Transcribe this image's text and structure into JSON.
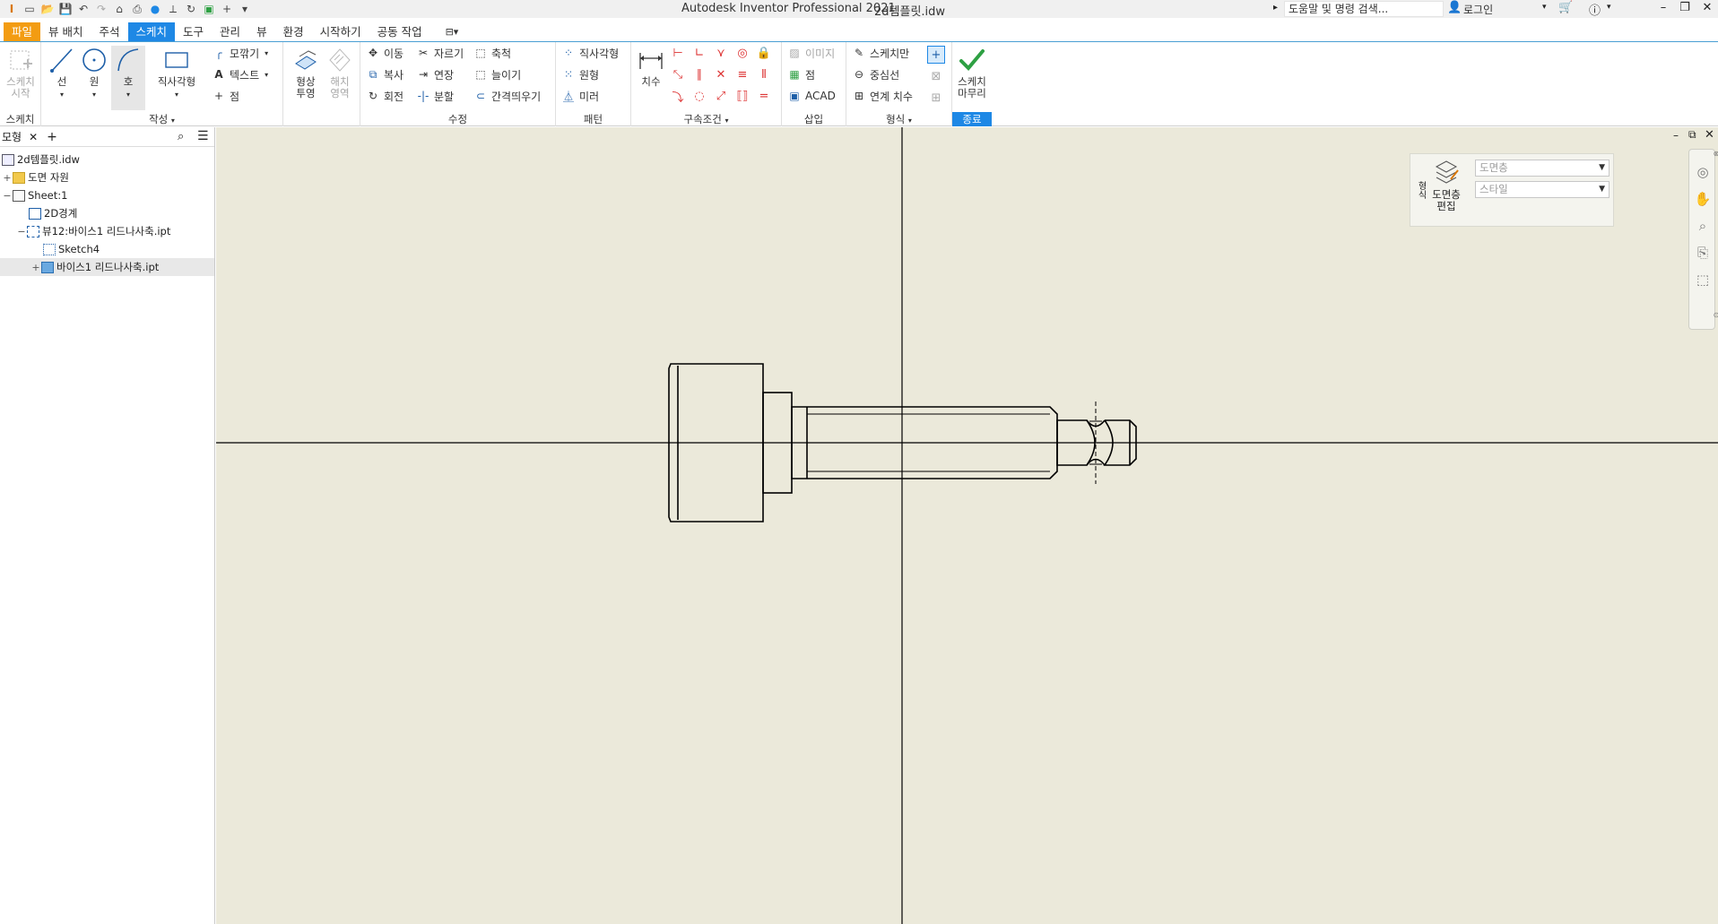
{
  "titlebar": {
    "app_title": "Autodesk Inventor Professional 2021",
    "doc_title": "2d템플릿.idw",
    "search_placeholder": "도움말 및 명령 검색...",
    "login": "로그인"
  },
  "tabs": [
    {
      "label": "파일"
    },
    {
      "label": "뷰 배치"
    },
    {
      "label": "주석"
    },
    {
      "label": "스케치"
    },
    {
      "label": "도구"
    },
    {
      "label": "관리"
    },
    {
      "label": "뷰"
    },
    {
      "label": "환경"
    },
    {
      "label": "시작하기"
    },
    {
      "label": "공동 작업"
    }
  ],
  "ribbon": {
    "sketch_panel": {
      "start_sketch": "스케치\n시작",
      "label": "스케치"
    },
    "create_panel": {
      "line": "선",
      "circle": "원",
      "arc": "호",
      "rectangle": "직사각형",
      "fillet": "모깎기",
      "text": "텍스트",
      "point": "점",
      "label": "작성"
    },
    "project_panel": {
      "project_geometry": "형상\n투영",
      "hatch": "해치\n영역"
    },
    "modify_panel": {
      "move": "이동",
      "trim": "자르기",
      "scale": "축척",
      "copy": "복사",
      "extend": "연장",
      "stretch": "늘이기",
      "rotate": "회전",
      "split": "분할",
      "offset": "간격띄우기",
      "label": "수정"
    },
    "pattern_panel": {
      "rectangular": "직사각형",
      "circular": "원형",
      "mirror": "미러",
      "label": "패턴"
    },
    "constrain_panel": {
      "dimension": "치수",
      "label": "구속조건"
    },
    "insert_panel": {
      "image": "이미지",
      "point": "점",
      "acad": "ACAD",
      "label": "삽입"
    },
    "format_panel": {
      "sketch_only": "스케치만",
      "centerline": "중심선",
      "driven_dim": "연계 치수",
      "label": "형식"
    },
    "exit_panel": {
      "finish_sketch": "스케치\n마무리",
      "label": "종료"
    }
  },
  "browser": {
    "tab_label": "모형",
    "tree": [
      {
        "label": "2d템플릿.idw"
      },
      {
        "label": "도면 자원"
      },
      {
        "label": "Sheet:1"
      },
      {
        "label": "2D경계"
      },
      {
        "label": "뷰12:바이스1 리드나사축.ipt"
      },
      {
        "label": "Sketch4"
      },
      {
        "label": "바이스1 리드나사축.ipt"
      }
    ]
  },
  "layer_panel": {
    "edit_label": "도면층\n편집",
    "side_label": "형식",
    "layer_dropdown": "도면층",
    "style_dropdown": "스타일"
  },
  "colors": {
    "accent": "#1e88e5",
    "file_tab": "#f39c12",
    "canvas": "#ebe9da",
    "finish_check": "#2ea043"
  }
}
